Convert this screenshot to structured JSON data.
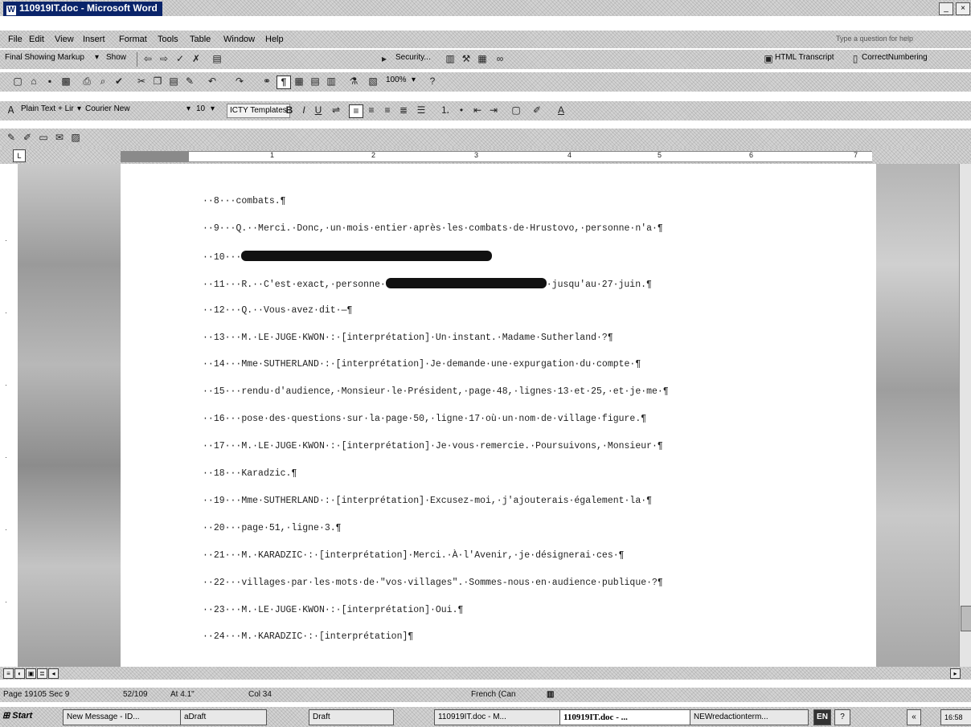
{
  "window": {
    "title": "110919IT.doc - Microsoft Word",
    "buttons": [
      "_",
      "×"
    ]
  },
  "menu": {
    "items": [
      "File",
      "Edit",
      "View",
      "Insert",
      "Format",
      "Tools",
      "Table",
      "Window",
      "Help"
    ],
    "help_placeholder": "Type a question for help"
  },
  "reviewing_toolbar": {
    "display_mode": "Final Showing Markup",
    "show_label": "Show",
    "security_label": "Security...",
    "html_transcript": "HTML Transcript",
    "correct_numbering": "CorrectNumbering"
  },
  "standard_toolbar": {
    "zoom": "100%"
  },
  "formatting_toolbar": {
    "style": "Plain Text + Lir",
    "font": "Courier New",
    "size": "10",
    "templates_button": "ICTY Templates"
  },
  "ruler": {
    "numbers": [
      "1",
      "2",
      "3",
      "4",
      "5",
      "6",
      "7"
    ]
  },
  "document": {
    "lines": [
      {
        "num": "8",
        "parts": [
          {
            "t": "text",
            "v": "combats.¶"
          }
        ]
      },
      {
        "num": "9",
        "parts": [
          {
            "t": "text",
            "v": "Q.··Merci.·Donc,·un·mois·entier·après·les·combats·de·Hrustovo,·personne·n'a·¶"
          }
        ]
      },
      {
        "num": "10",
        "parts": [
          {
            "t": "redact",
            "w": 312
          }
        ]
      },
      {
        "num": "11",
        "parts": [
          {
            "t": "text",
            "v": "R.··C'est·exact,·personne·"
          },
          {
            "t": "redact",
            "w": 200
          },
          {
            "t": "text",
            "v": "·jusqu'au·27·juin.¶"
          }
        ]
      },
      {
        "num": "12",
        "parts": [
          {
            "t": "text",
            "v": "Q.··Vous·avez·dit·—¶"
          }
        ]
      },
      {
        "num": "13",
        "parts": [
          {
            "t": "text",
            "v": "M.·LE·JUGE·KWON·:·[interprétation]·Un·instant.·Madame·Sutherland·?¶"
          }
        ]
      },
      {
        "num": "14",
        "parts": [
          {
            "t": "text",
            "v": "Mme·SUTHERLAND·:·[interprétation]·Je·demande·une·expurgation·du·compte·¶"
          }
        ]
      },
      {
        "num": "15",
        "parts": [
          {
            "t": "text",
            "v": "rendu·d'audience,·Monsieur·le·Président,·page·48,·lignes·13·et·25,·et·je·me·¶"
          }
        ]
      },
      {
        "num": "16",
        "parts": [
          {
            "t": "text",
            "v": "pose·des·questions·sur·la·page·50,·ligne·17·où·un·nom·de·village·figure.¶"
          }
        ]
      },
      {
        "num": "17",
        "parts": [
          {
            "t": "text",
            "v": "M.·LE·JUGE·KWON·:·[interprétation]·Je·vous·remercie.·Poursuivons,·Monsieur·¶"
          }
        ]
      },
      {
        "num": "18",
        "parts": [
          {
            "t": "text",
            "v": "Karadzic.¶"
          }
        ]
      },
      {
        "num": "19",
        "parts": [
          {
            "t": "text",
            "v": "Mme·SUTHERLAND·:·[interprétation]·Excusez-moi,·j'ajouterais·également·la·¶"
          }
        ]
      },
      {
        "num": "20",
        "parts": [
          {
            "t": "text",
            "v": "page·51,·ligne·3.¶"
          }
        ]
      },
      {
        "num": "21",
        "parts": [
          {
            "t": "text",
            "v": "M.·KARADZIC·:·[interprétation]·Merci.·À·l'Avenir,·je·désignerai·ces·¶"
          }
        ]
      },
      {
        "num": "22",
        "parts": [
          {
            "t": "text",
            "v": "villages·par·les·mots·de·\"vos·villages\".·Sommes-nous·en·audience·publique·?¶"
          }
        ]
      },
      {
        "num": "23",
        "parts": [
          {
            "t": "text",
            "v": "M.·LE·JUGE·KWON·:·[interprétation]·Oui.¶"
          }
        ]
      },
      {
        "num": "24",
        "parts": [
          {
            "t": "text",
            "v": "M.·KARADZIC·:·[interprétation]¶"
          }
        ]
      }
    ]
  },
  "status": {
    "page": "Page 19105 Sec 9",
    "pages": "52/109",
    "at": "At 4.1\"",
    "col": "Col 34",
    "language": "French (Can"
  },
  "taskbar": {
    "start": "Start",
    "tasks": [
      "New Message - ID...",
      "aDraft",
      "Draft",
      "110919IT.doc - M...",
      "110919IT.doc - ...",
      "NEWredactionterm..."
    ],
    "lang": "EN",
    "clock": "16:58"
  }
}
